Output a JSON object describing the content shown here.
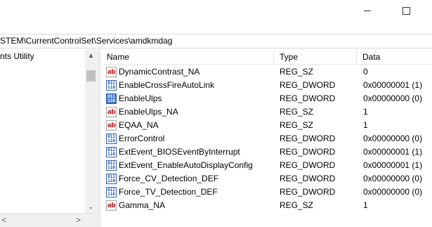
{
  "address": "STEM\\CurrentControlSet\\Services\\amdkmdag",
  "tree": {
    "item": "nts Utility"
  },
  "columns": {
    "name": "Name",
    "type": "Type",
    "data": "Data"
  },
  "rows": [
    {
      "icon": "string",
      "name": "DynamicContrast_NA",
      "type": "REG_SZ",
      "data": "0"
    },
    {
      "icon": "dword",
      "name": "EnableCrossFireAutoLink",
      "type": "REG_DWORD",
      "data": "0x00000001 (1)"
    },
    {
      "icon": "dword-selected",
      "name": "EnableUlps",
      "type": "REG_DWORD",
      "data": "0x00000000 (0)"
    },
    {
      "icon": "string",
      "name": "EnableUlps_NA",
      "type": "REG_SZ",
      "data": "1"
    },
    {
      "icon": "string",
      "name": "EQAA_NA",
      "type": "REG_SZ",
      "data": "1"
    },
    {
      "icon": "dword",
      "name": "ErrorControl",
      "type": "REG_DWORD",
      "data": "0x00000000 (0)"
    },
    {
      "icon": "dword",
      "name": "ExtEvent_BIOSEventByInterrupt",
      "type": "REG_DWORD",
      "data": "0x00000001 (1)"
    },
    {
      "icon": "dword",
      "name": "ExtEvent_EnableAutoDisplayConfig",
      "type": "REG_DWORD",
      "data": "0x00000001 (1)"
    },
    {
      "icon": "dword",
      "name": "Force_CV_Detection_DEF",
      "type": "REG_DWORD",
      "data": "0x00000000 (0)"
    },
    {
      "icon": "dword",
      "name": "Force_TV_Detection_DEF",
      "type": "REG_DWORD",
      "data": "0x00000000 (0)"
    },
    {
      "icon": "string",
      "name": "Gamma_NA",
      "type": "REG_SZ",
      "data": "1"
    }
  ],
  "icon_glyphs": {
    "string": "ab",
    "dword_top": "011",
    "dword_bottom": "110"
  }
}
